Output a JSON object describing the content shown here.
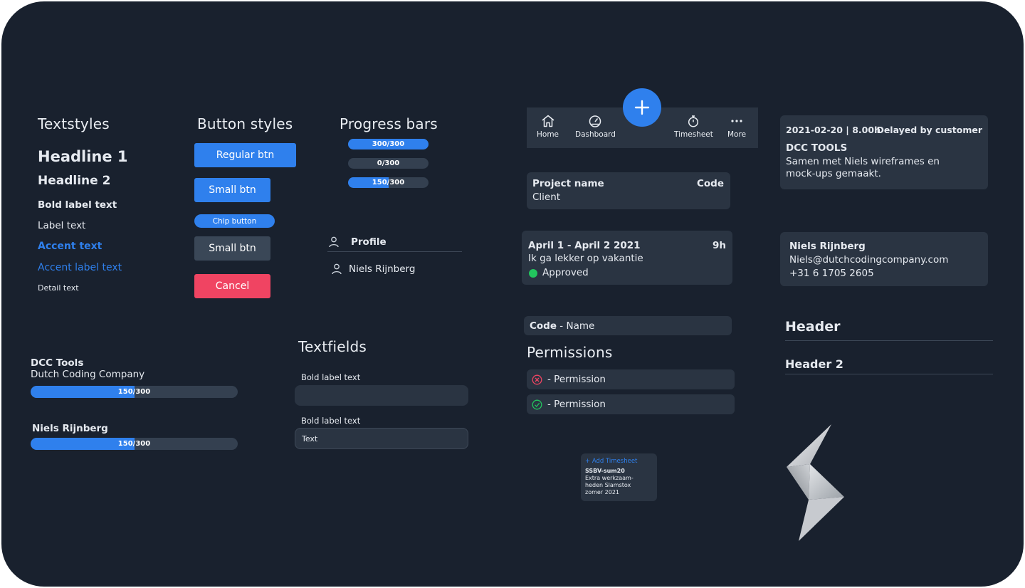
{
  "textstyles": {
    "title": "Textstyles",
    "headline1": "Headline 1",
    "headline2": "Headline 2",
    "bold_label": "Bold label text",
    "label": "Label text",
    "accent": "Accent text",
    "accent_label": "Accent label text",
    "detail": "Detail text"
  },
  "buttons": {
    "title": "Button styles",
    "regular": "Regular btn",
    "small": "Small btn",
    "chip": "Chip button",
    "small_gray": "Small btn",
    "cancel": "Cancel"
  },
  "progress": {
    "title": "Progress bars",
    "bars": [
      {
        "label": "300/300",
        "value": 300,
        "max": 300
      },
      {
        "label": "0/300",
        "value": 0,
        "max": 300
      },
      {
        "label": "150/300",
        "value": 150,
        "max": 300
      }
    ]
  },
  "profile": {
    "header": "Profile",
    "name": "Niels Rijnberg"
  },
  "project_bars": [
    {
      "title": "DCC Tools",
      "subtitle": "Dutch Coding Company",
      "label": "150/300",
      "value": 150,
      "max": 300
    },
    {
      "title": "Niels Rijnberg",
      "subtitle": "",
      "label": "150/300",
      "value": 150,
      "max": 300
    }
  ],
  "textfields": {
    "title": "Textfields",
    "field1_label": "Bold label text",
    "field1_value": "",
    "field2_label": "Bold label text",
    "field2_value": "Text"
  },
  "nav": {
    "items": [
      "Home",
      "Dashboard",
      "Timesheet",
      "More"
    ]
  },
  "project_card": {
    "name_label": "Project name",
    "code_label": "Code",
    "client": "Client"
  },
  "entry_card": {
    "dates": "April 1 - April 2 2021",
    "hours": "9h",
    "description": "Ik ga lekker op vakantie",
    "status": "Approved"
  },
  "code_name": {
    "code": "Code",
    "name": " - Name"
  },
  "permissions": {
    "title": "Permissions",
    "items": [
      {
        "label": "-  Permission",
        "granted": false
      },
      {
        "label": "-  Permission",
        "granted": true
      }
    ]
  },
  "add_timesheet": {
    "action": "+  Add Timesheet",
    "code": "SSBV-sum20",
    "lines": [
      "Extra werkzaam-",
      "heden Slamstox",
      "zomer 2021"
    ]
  },
  "log_card": {
    "date_hours": "2021-02-20 | 8.00h",
    "status": "Delayed by customer",
    "company": "DCC TOOLS",
    "lines": [
      "Samen met Niels wireframes en",
      "mock-ups gemaakt."
    ]
  },
  "contact_card": {
    "name": "Niels Rijnberg",
    "email": "Niels@dutchcodingcompany.com",
    "phone": "+31 6 1705 2605"
  },
  "headers": {
    "header1": "Header",
    "header2": "Header 2"
  },
  "colors": {
    "background": "#19212e",
    "accent": "#2f80ed",
    "danger": "#f04462",
    "success": "#22c55e",
    "card": "#2a3442"
  }
}
